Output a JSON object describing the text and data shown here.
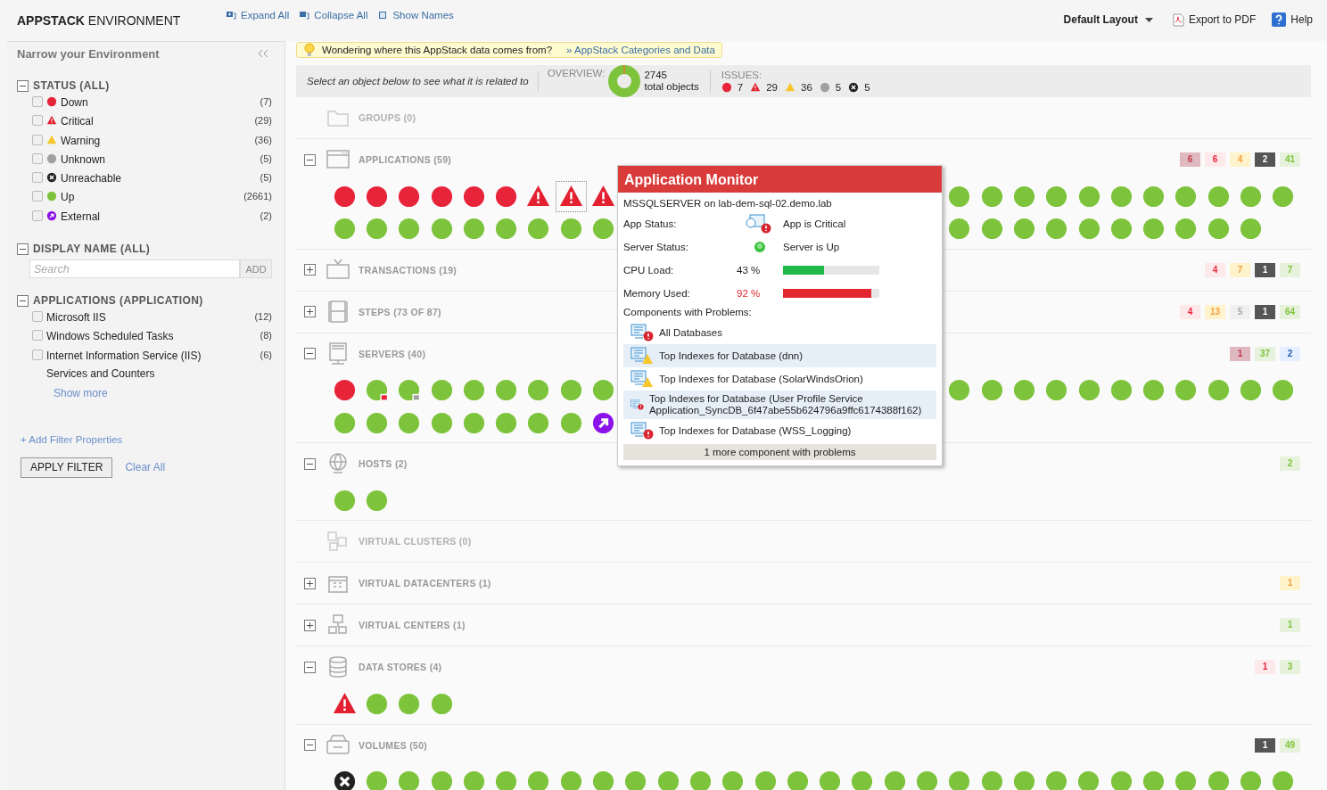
{
  "header": {
    "title": "**APPSTACK** ENVIRONMENT",
    "tools": [
      {
        "kind": "expand",
        "label": "Expand All"
      },
      {
        "kind": "collapse",
        "label": "Collapse All"
      },
      {
        "kind": "names",
        "label": "Show Names"
      }
    ],
    "layout": "Default Layout",
    "export": "Export to PDF",
    "help": "Help"
  },
  "sidebar": {
    "title": "Narrow your Environment",
    "groups": [
      {
        "kind": "checklist",
        "title": "STATUS (ALL)",
        "expanded": true,
        "items": [
          {
            "kind": "down",
            "label": "Down",
            "count": "(7)",
            "checked": false
          },
          {
            "kind": "critical",
            "label": "Critical",
            "count": "(29)",
            "checked": false
          },
          {
            "kind": "warning",
            "label": "Warning",
            "count": "(36)",
            "checked": false
          },
          {
            "kind": "unknown",
            "label": "Unknown",
            "count": "(5)",
            "checked": false
          },
          {
            "kind": "unreachable",
            "label": "Unreachable",
            "count": "(5)",
            "checked": false
          },
          {
            "kind": "up",
            "label": "Up",
            "count": "(2661)",
            "checked": false
          },
          {
            "kind": "external",
            "label": "External",
            "count": "(2)",
            "checked": false
          }
        ]
      },
      {
        "kind": "search",
        "title": "DISPLAY NAME (ALL)",
        "expanded": true,
        "placeholder": "Search",
        "button": "ADD"
      },
      {
        "kind": "checklist",
        "title": "APPLICATIONS (APPLICATION)",
        "expanded": true,
        "items": [
          {
            "label": "Microsoft IIS",
            "count": "(12)",
            "checked": false
          },
          {
            "label": "Windows Scheduled Tasks",
            "count": "(8)",
            "checked": false
          },
          {
            "label": "Internet Information Service (IIS) Services and Counters",
            "count": "(6)",
            "checked": false
          }
        ],
        "more": "Show more"
      }
    ],
    "add_filter": "+ Add Filter Properties",
    "apply": "APPLY FILTER",
    "clear": "Clear All"
  },
  "hint": {
    "text": "Wondering where this AppStack data comes from?",
    "link": "» AppStack Categories and Data"
  },
  "summary": {
    "prompt": "Select an object below to see what it is related to",
    "overview_label": "OVERVIEW:",
    "total": "2745",
    "total_label": "total objects",
    "issues_label": "ISSUES:",
    "issues": [
      {
        "kind": "down",
        "count": "7"
      },
      {
        "kind": "critical",
        "count": "29"
      },
      {
        "kind": "warning",
        "count": "36"
      },
      {
        "kind": "unknown",
        "count": "5"
      },
      {
        "kind": "unreachable",
        "count": "5"
      }
    ]
  },
  "categories": [
    {
      "kind": "groups",
      "label": "GROUPS (0)"
    },
    {
      "kind": "applications",
      "label": "APPLICATIONS (59)",
      "expanded": true,
      "badges": [
        {
          "kind": "down",
          "count": "6"
        },
        {
          "kind": "critical",
          "count": "6"
        },
        {
          "kind": "warning",
          "count": "4"
        },
        {
          "kind": "unreachable",
          "count": "2"
        },
        {
          "kind": "up",
          "count": "41"
        }
      ],
      "rows": [
        {
          "segments": [
            [
              {
                "kind": "down",
                "selected": false
              },
              {
                "kind": "down",
                "selected": false
              },
              {
                "kind": "down",
                "selected": false
              },
              {
                "kind": "down",
                "selected": false
              },
              {
                "kind": "down",
                "selected": false
              },
              {
                "kind": "down",
                "selected": false
              },
              {
                "kind": "critical",
                "selected": false
              },
              {
                "kind": "critical",
                "selected": true
              },
              {
                "kind": "critical",
                "selected": false
              }
            ],
            [
              {
                "kind": "up",
                "selected": false
              },
              {
                "kind": "up",
                "selected": false
              },
              {
                "kind": "up",
                "selected": false
              },
              {
                "kind": "up",
                "selected": false
              },
              {
                "kind": "up",
                "selected": false
              },
              {
                "kind": "up",
                "selected": false
              },
              {
                "kind": "up",
                "selected": false
              },
              {
                "kind": "up",
                "selected": false
              },
              {
                "kind": "up",
                "selected": false
              },
              {
                "kind": "up",
                "selected": false
              },
              {
                "kind": "up",
                "selected": false
              }
            ]
          ]
        },
        {
          "segments": [
            [
              {
                "kind": "up",
                "selected": false
              },
              {
                "kind": "up",
                "selected": false
              },
              {
                "kind": "up",
                "selected": false
              },
              {
                "kind": "up",
                "selected": false
              },
              {
                "kind": "up",
                "selected": false
              },
              {
                "kind": "up",
                "selected": false
              },
              {
                "kind": "up",
                "selected": false
              },
              {
                "kind": "up",
                "selected": false
              },
              {
                "kind": "up",
                "selected": false
              }
            ],
            [
              {
                "kind": "up",
                "selected": false
              },
              {
                "kind": "up",
                "selected": false
              },
              {
                "kind": "up",
                "selected": false
              },
              {
                "kind": "up",
                "selected": false
              },
              {
                "kind": "up",
                "selected": false
              },
              {
                "kind": "up",
                "selected": false
              },
              {
                "kind": "up",
                "selected": false
              },
              {
                "kind": "up",
                "selected": false
              },
              {
                "kind": "up",
                "selected": false
              },
              {
                "kind": "up",
                "selected": false
              }
            ]
          ]
        }
      ]
    },
    {
      "kind": "transactions",
      "label": "TRANSACTIONS (19)",
      "expanded": false,
      "badges": [
        {
          "kind": "critical",
          "count": "4"
        },
        {
          "kind": "warning",
          "count": "7"
        },
        {
          "kind": "unreachable",
          "count": "1"
        },
        {
          "kind": "up",
          "count": "7"
        }
      ]
    },
    {
      "kind": "steps",
      "label": "STEPS (73 OF 87)",
      "expanded": false,
      "badges": [
        {
          "kind": "critical",
          "count": "4"
        },
        {
          "kind": "warning",
          "count": "13"
        },
        {
          "kind": "unknown",
          "count": "5"
        },
        {
          "kind": "unreachable",
          "count": "1"
        },
        {
          "kind": "up",
          "count": "64"
        }
      ]
    },
    {
      "kind": "servers",
      "label": "SERVERS (40)",
      "expanded": true,
      "badges": [
        {
          "kind": "down",
          "count": "1"
        },
        {
          "kind": "up",
          "count": "37"
        },
        {
          "kind": "external",
          "count": "2"
        }
      ],
      "rows": [
        {
          "segments": [
            [
              {
                "kind": "down",
                "selected": false
              },
              {
                "kind": "up-child-down",
                "selected": false
              },
              {
                "kind": "up-child-unknown",
                "selected": false
              },
              {
                "kind": "up",
                "selected": false
              },
              {
                "kind": "up",
                "selected": false
              },
              {
                "kind": "up",
                "selected": false
              },
              {
                "kind": "up",
                "selected": false
              },
              {
                "kind": "up",
                "selected": false
              },
              {
                "kind": "up",
                "selected": false
              }
            ],
            [
              {
                "kind": "up",
                "selected": false
              },
              {
                "kind": "up",
                "selected": false
              },
              {
                "kind": "up",
                "selected": false
              },
              {
                "kind": "up",
                "selected": false
              },
              {
                "kind": "up",
                "selected": false
              },
              {
                "kind": "up",
                "selected": false
              },
              {
                "kind": "up",
                "selected": false
              },
              {
                "kind": "up",
                "selected": false
              },
              {
                "kind": "up",
                "selected": false
              },
              {
                "kind": "up",
                "selected": false
              },
              {
                "kind": "up",
                "selected": false
              }
            ]
          ]
        },
        {
          "segments": [
            [
              {
                "kind": "up",
                "selected": false
              },
              {
                "kind": "up",
                "selected": false
              },
              {
                "kind": "up",
                "selected": false
              },
              {
                "kind": "up",
                "selected": false
              },
              {
                "kind": "up",
                "selected": false
              },
              {
                "kind": "up",
                "selected": false
              },
              {
                "kind": "up",
                "selected": false
              },
              {
                "kind": "up",
                "selected": false
              },
              {
                "kind": "external",
                "selected": false
              }
            ]
          ]
        }
      ]
    },
    {
      "kind": "hosts",
      "label": "HOSTS (2)",
      "expanded": true,
      "badges": [
        {
          "kind": "up",
          "count": "2"
        }
      ],
      "rows": [
        {
          "segments": [
            [
              {
                "kind": "up",
                "selected": false
              },
              {
                "kind": "up",
                "selected": false
              }
            ]
          ]
        }
      ]
    },
    {
      "kind": "clusters",
      "label": "VIRTUAL CLUSTERS (0)"
    },
    {
      "kind": "datacenters",
      "label": "VIRTUAL DATACENTERS (1)",
      "expanded": false,
      "badges": [
        {
          "kind": "warning",
          "count": "1"
        }
      ]
    },
    {
      "kind": "vcenters",
      "label": "VIRTUAL CENTERS (1)",
      "expanded": false,
      "badges": [
        {
          "kind": "up",
          "count": "1"
        }
      ]
    },
    {
      "kind": "datastores",
      "label": "DATA STORES (4)",
      "expanded": true,
      "badges": [
        {
          "kind": "critical",
          "count": "1"
        },
        {
          "kind": "up",
          "count": "3"
        }
      ],
      "rows": [
        {
          "segments": [
            [
              {
                "kind": "critical",
                "selected": false
              },
              {
                "kind": "up",
                "selected": false
              },
              {
                "kind": "up",
                "selected": false
              },
              {
                "kind": "up",
                "selected": false
              }
            ]
          ]
        }
      ]
    },
    {
      "kind": "volumes",
      "label": "VOLUMES (50)",
      "expanded": true,
      "badges": [
        {
          "kind": "unreachable",
          "count": "1"
        },
        {
          "kind": "up",
          "count": "49"
        }
      ],
      "rows": [
        {
          "segments": [
            [
              {
                "kind": "unreachable",
                "selected": false
              },
              {
                "kind": "up",
                "selected": false
              },
              {
                "kind": "up",
                "selected": false
              },
              {
                "kind": "up",
                "selected": false
              },
              {
                "kind": "up",
                "selected": false
              },
              {
                "kind": "up",
                "selected": false
              },
              {
                "kind": "up",
                "selected": false
              },
              {
                "kind": "up",
                "selected": false
              },
              {
                "kind": "up",
                "selected": false
              },
              {
                "kind": "up",
                "selected": false
              },
              {
                "kind": "up",
                "selected": false
              },
              {
                "kind": "up",
                "selected": false
              },
              {
                "kind": "up",
                "selected": false
              },
              {
                "kind": "up",
                "selected": false
              },
              {
                "kind": "up",
                "selected": false
              },
              {
                "kind": "up",
                "selected": false
              },
              {
                "kind": "up",
                "selected": false
              },
              {
                "kind": "up",
                "selected": false
              },
              {
                "kind": "up",
                "selected": false
              },
              {
                "kind": "up",
                "selected": false
              },
              {
                "kind": "up",
                "selected": false
              },
              {
                "kind": "up",
                "selected": false
              },
              {
                "kind": "up",
                "selected": false
              },
              {
                "kind": "up",
                "selected": false
              },
              {
                "kind": "up",
                "selected": false
              },
              {
                "kind": "up",
                "selected": false
              },
              {
                "kind": "up",
                "selected": false
              },
              {
                "kind": "up",
                "selected": false
              },
              {
                "kind": "up",
                "selected": false
              },
              {
                "kind": "up",
                "selected": false
              }
            ]
          ]
        }
      ]
    }
  ],
  "popup": {
    "title": "Application Monitor",
    "subtitle": "MSSQLSERVER on lab-dem-sql-02.demo.lab",
    "statuses": [
      {
        "kind": "app-critical",
        "label": "App Status:",
        "text": "App is Critical"
      },
      {
        "kind": "server-up",
        "label": "Server Status:",
        "text": "Server is Up"
      }
    ],
    "metrics": [
      {
        "label": "CPU Load:",
        "value": "43 %",
        "level": 0.43,
        "kind": "ok"
      },
      {
        "label": "Memory Used:",
        "value": "92 %",
        "level": 0.92,
        "kind": "critical"
      }
    ],
    "components_label": "Components with Problems:",
    "components": [
      {
        "kind": "critical",
        "label": "All Databases"
      },
      {
        "kind": "warning",
        "label": "Top Indexes for Database (dnn)"
      },
      {
        "kind": "warning",
        "label": "Top Indexes for Database (SolarWindsOrion)"
      },
      {
        "kind": "critical",
        "label": "Top Indexes for Database (User Profile Service Application_SyncDB_6f47abe55b624796a9ffc6174388f162)"
      },
      {
        "kind": "critical",
        "label": "Top Indexes for Database (WSS_Logging)"
      }
    ],
    "footer": "1 more component with problems"
  }
}
